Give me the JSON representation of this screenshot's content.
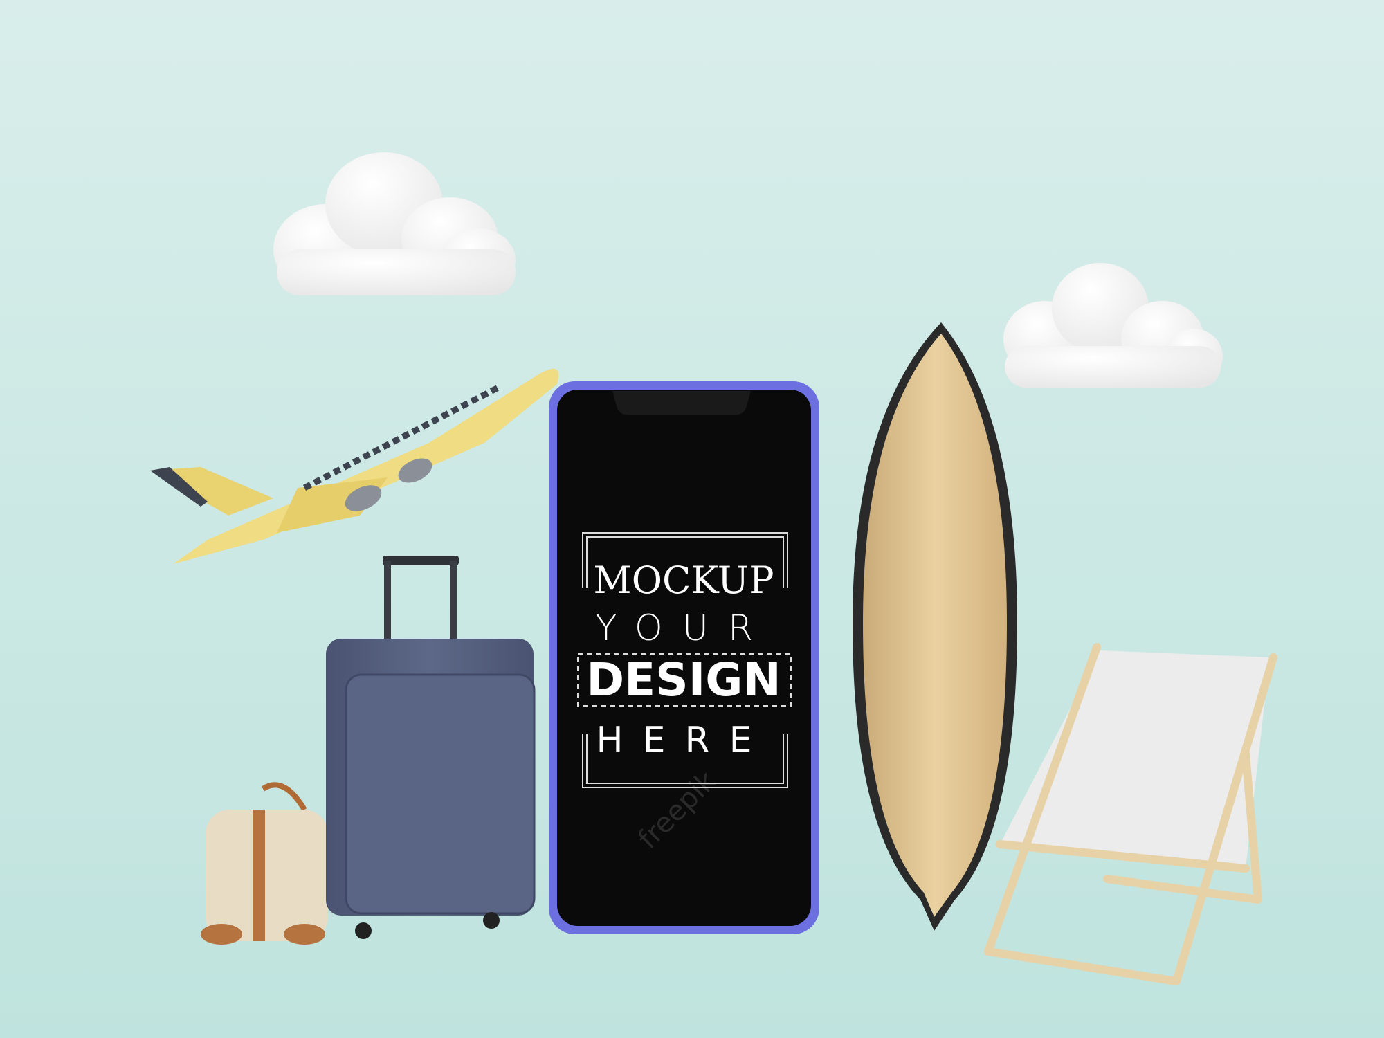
{
  "screen": {
    "line1": "MOCKUP",
    "line2": "YOUR",
    "line3": "DESIGN",
    "line4": "HERE"
  },
  "watermark": "freepik",
  "colors": {
    "background": "#d3ebe8",
    "phone_frame": "#6b6fe0",
    "screen": "#0a0a0a",
    "plane": "#f0dc82",
    "suitcase": "#55607f",
    "surfboard": "#e2c896",
    "cloud": "#f7f7f7"
  }
}
